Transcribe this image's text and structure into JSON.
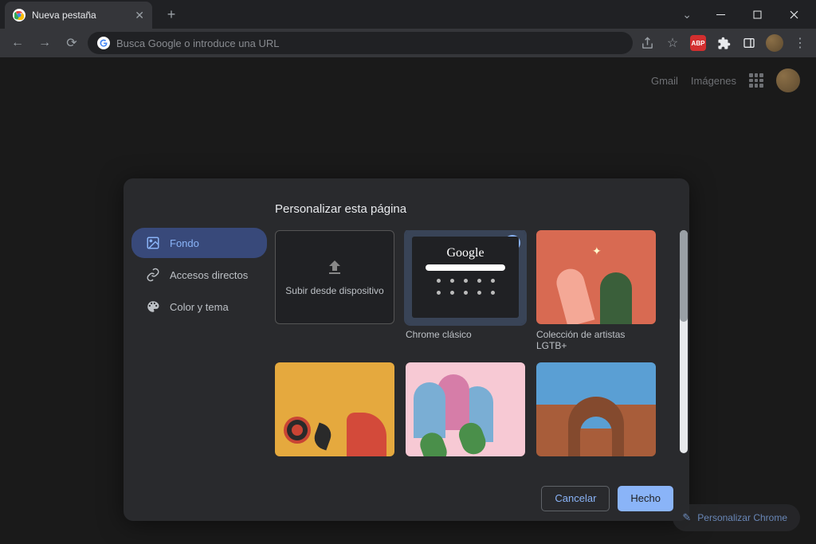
{
  "window": {
    "tab_title": "Nueva pestaña",
    "new_tab": "+"
  },
  "toolbar": {
    "placeholder": "Busca Google o introduce una URL",
    "abp": "ABP"
  },
  "ntp": {
    "gmail": "Gmail",
    "images": "Imágenes",
    "customize_label": "Personalizar Chrome"
  },
  "dialog": {
    "title": "Personalizar esta página",
    "sidebar": {
      "background": "Fondo",
      "shortcuts": "Accesos directos",
      "theme": "Color y tema"
    },
    "tiles": {
      "upload": "Subir desde dispositivo",
      "classic": "Chrome clásico",
      "classic_logo": "Google",
      "lgbt": "Colección de artistas LGTB+"
    },
    "buttons": {
      "cancel": "Cancelar",
      "done": "Hecho"
    }
  }
}
